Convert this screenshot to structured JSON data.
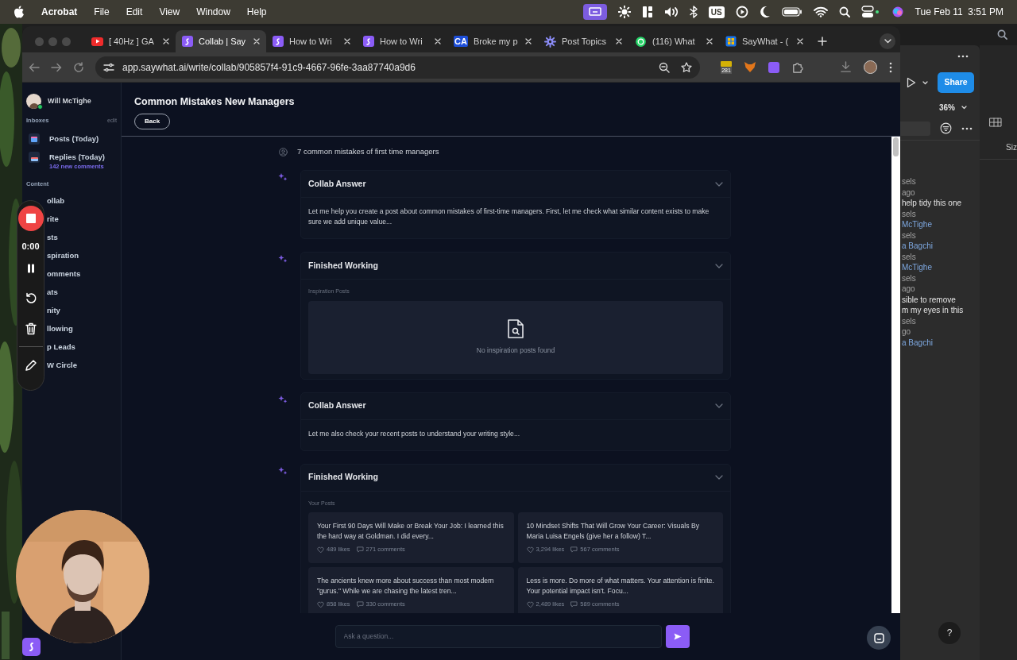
{
  "menu_bar": {
    "app": "Acrobat",
    "menus": [
      "File",
      "Edit",
      "View",
      "Window",
      "Help"
    ],
    "keyboard": "US",
    "clock": "Tue Feb 11  3:51 PM"
  },
  "browser": {
    "tabs": [
      {
        "title": "[ 40Hz ] GA",
        "kind": "video",
        "selected": false
      },
      {
        "title": "Collab | Say",
        "kind": "app",
        "selected": true
      },
      {
        "title": "How to Wri",
        "kind": "app",
        "selected": false
      },
      {
        "title": "How to Wri",
        "kind": "app",
        "selected": false
      },
      {
        "title": "Broke my p",
        "kind": "initials",
        "initials": "CA",
        "selected": false
      },
      {
        "title": "Post Topics",
        "kind": "gear",
        "selected": false
      },
      {
        "title": "(116) What",
        "kind": "chat",
        "selected": false
      },
      {
        "title": "SayWhat - (",
        "kind": "sheet",
        "selected": false
      }
    ],
    "address": "app.saywhat.ai/write/collab/905857f4-91c9-4667-96fe-3aa87740a9d6",
    "extension_badge": "281"
  },
  "sidebar": {
    "user": "Will McTighe",
    "inboxes_label": "Inboxes",
    "edit": "edit",
    "inboxes": [
      {
        "label": "Posts (Today)",
        "kind": "posts"
      },
      {
        "label": "Replies (Today)",
        "kind": "replies",
        "note": "142 new comments"
      }
    ],
    "content_label": "Content",
    "items": [
      "ollab",
      "rite",
      "sts",
      "spiration",
      "omments",
      "ats",
      "nity",
      "llowing",
      "p Leads",
      "W Circle"
    ]
  },
  "recorder": {
    "time": "0:00"
  },
  "page": {
    "title": "Common Mistakes New Managers",
    "back": "Back"
  },
  "chat": {
    "prompt": "7 common mistakes of first time managers",
    "messages": [
      {
        "kind": "answer",
        "title": "Collab Answer",
        "text": "Let me help you create a post about common mistakes of first-time managers. First, let me check what similar content exists to make sure we add unique value..."
      },
      {
        "kind": "working",
        "title": "Finished Working",
        "section": "Inspiration Posts",
        "empty_text": "No inspiration posts found"
      },
      {
        "kind": "answer",
        "title": "Collab Answer",
        "text": "Let me also check your recent posts to understand your writing style..."
      },
      {
        "kind": "working",
        "title": "Finished Working",
        "section": "Your Posts",
        "posts": [
          {
            "text": "Your First 90 Days Will Make or Break Your Job: I learned this the hard way at Goldman. I did every...",
            "likes": "489 likes",
            "comments": "271 comments"
          },
          {
            "text": "10 Mindset Shifts That Will Grow Your Career: Visuals By Maria Luisa Engels (give her a follow) T...",
            "likes": "3,294 likes",
            "comments": "567 comments"
          },
          {
            "text": "The ancients knew more about success than most modern \"gurus.\" While we are chasing the latest tren...",
            "likes": "858 likes",
            "comments": "330 comments"
          },
          {
            "text": "Less is more. Do more of what matters. Your attention is finite. Your potential impact isn't. Focu...",
            "likes": "2,489 likes",
            "comments": "589 comments"
          }
        ]
      }
    ]
  },
  "composer": {
    "placeholder": "Ask a question..."
  },
  "background_app": {
    "share": "Share",
    "zoom": "36%",
    "column": "Siz",
    "help": "?",
    "comments": [
      [
        {
          "text": "sels",
          "kind": "meta"
        },
        {
          "text": "ago",
          "kind": "meta"
        },
        {
          "text": "help tidy this one",
          "kind": "body"
        }
      ],
      [
        {
          "text": "sels",
          "kind": "meta"
        },
        {
          "text": "McTighe",
          "kind": "name"
        }
      ],
      [
        {
          "text": "sels",
          "kind": "meta"
        },
        {
          "text": "a Bagchi",
          "kind": "name"
        }
      ],
      [
        {
          "text": "sels",
          "kind": "meta"
        },
        {
          "text": "McTighe",
          "kind": "name"
        }
      ],
      [
        {
          "text": "sels",
          "kind": "meta"
        },
        {
          "text": "ago",
          "kind": "meta"
        },
        {
          "text": "sible to remove",
          "kind": "body"
        },
        {
          "text": "m my eyes in this",
          "kind": "body"
        }
      ],
      [
        {
          "text": "sels",
          "kind": "meta"
        },
        {
          "text": "go",
          "kind": "meta"
        },
        {
          "text": "a Bagchi",
          "kind": "name"
        }
      ]
    ]
  }
}
